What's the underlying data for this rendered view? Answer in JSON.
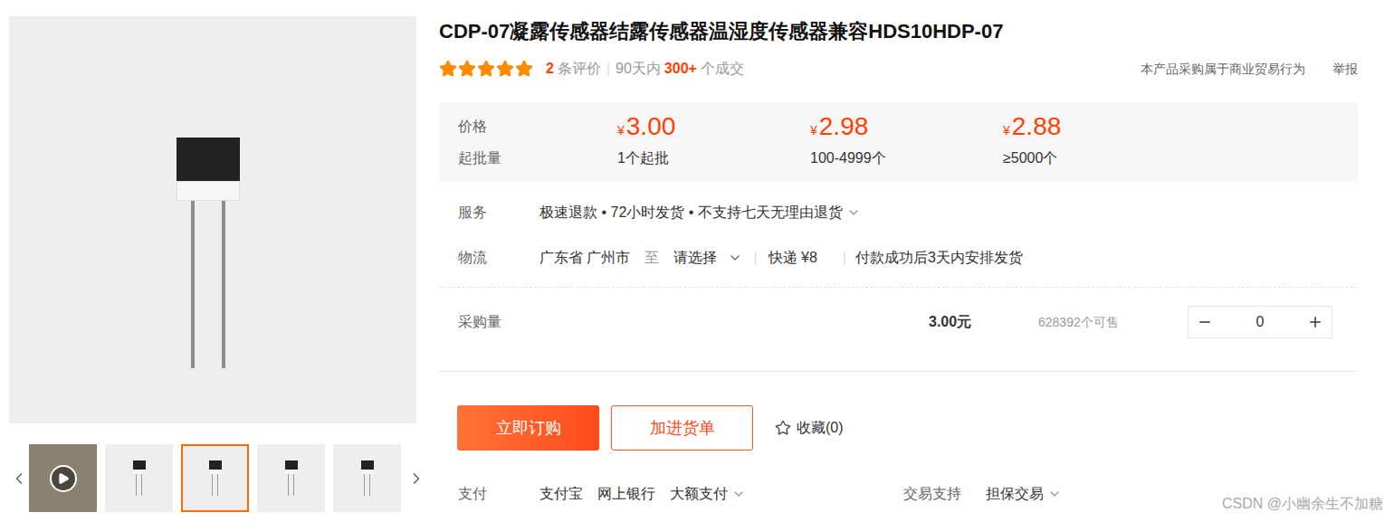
{
  "product": {
    "title": "CDP-07凝露传感器结露传感器温湿度传感器兼容HDS10HDP-07"
  },
  "gallery": {
    "thumbnails": [
      {
        "kind": "video",
        "selected": false
      },
      {
        "kind": "photo",
        "selected": false
      },
      {
        "kind": "photo",
        "selected": true
      },
      {
        "kind": "photo",
        "selected": false
      },
      {
        "kind": "photo",
        "selected": false
      }
    ]
  },
  "rating": {
    "stars": 5,
    "review_count": "2",
    "review_label": "条评价",
    "separator": "|",
    "period": "90天内",
    "deals": "300+",
    "deals_label": "个成交"
  },
  "notice": {
    "text": "本产品采购属于商业贸易行为",
    "report": "举报"
  },
  "price_table": {
    "price_label": "价格",
    "qty_label": "起批量",
    "tiers": [
      {
        "currency": "¥",
        "amount": "3.00",
        "min_qty": "1个起批"
      },
      {
        "currency": "¥",
        "amount": "2.98",
        "min_qty": "100-4999个"
      },
      {
        "currency": "¥",
        "amount": "2.88",
        "min_qty": "≥5000个"
      }
    ]
  },
  "service": {
    "label": "服务",
    "text": "极速退款 • 72小时发货 • 不支持七天无理由退货"
  },
  "logistics": {
    "label": "物流",
    "origin": "广东省 广州市",
    "to": "至",
    "destination": "请选择",
    "separator": "|",
    "shipping": "快递 ¥8",
    "dispatch": "付款成功后3天内安排发货"
  },
  "purchase": {
    "label": "采购量",
    "total": "3.00元",
    "stock": "628392个可售",
    "quantity": "0"
  },
  "actions": {
    "buy": "立即订购",
    "cart": "加进货单",
    "favorite": "收藏(0)"
  },
  "payment": {
    "label": "支付",
    "methods": [
      {
        "name": "支付宝",
        "kind": "plain"
      },
      {
        "name": "网上银行",
        "kind": "plain"
      },
      {
        "name": "大额支付",
        "kind": "menu"
      }
    ]
  },
  "trade_support": {
    "label": "交易支持",
    "value": "担保交易"
  },
  "watermark": "CSDN @小幽余生不加糖"
}
